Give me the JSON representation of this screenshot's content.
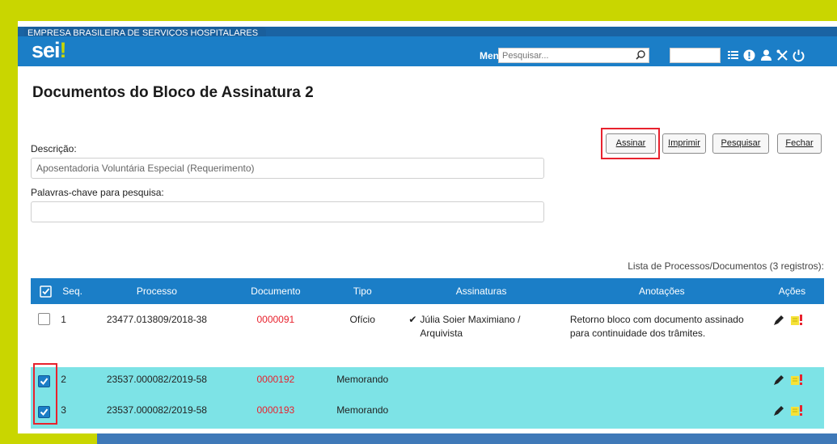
{
  "header": {
    "org_name": "EMPRESA BRASILEIRA DE SERVIÇOS HOSPITALARES",
    "logo_text": "sei",
    "logo_dot": "!",
    "menu_label": "Menu",
    "search_placeholder": "Pesquisar...",
    "icons": [
      "search-icon",
      "list-icon",
      "info-icon",
      "user-icon",
      "tools-icon",
      "power-icon"
    ]
  },
  "page": {
    "title": "Documentos do Bloco de Assinatura 2",
    "buttons": {
      "assinar": "Assinar",
      "imprimir": "Imprimir",
      "pesquisar": "Pesquisar",
      "fechar": "Fechar"
    },
    "descricao_label": "Descrição:",
    "descricao_value": "Aposentadoria Voluntária Especial (Requerimento)",
    "palavras_label": "Palavras-chave para pesquisa:",
    "palavras_value": ""
  },
  "table": {
    "caption": "Lista de Processos/Documentos (3 registros):",
    "columns": [
      "Seq.",
      "Processo",
      "Documento",
      "Tipo",
      "Assinaturas",
      "Anotações",
      "Ações"
    ],
    "rows": [
      {
        "checked": false,
        "seq": "1",
        "processo": "23477.013809/2018-38",
        "documento": "0000091",
        "tipo": "Ofício",
        "assinatura_check": "✔",
        "assinaturas": "Júlia Soier Maximiano / Arquivista",
        "anotacoes": "Retorno bloco com documento assinado para continuidade dos trâmites."
      },
      {
        "checked": true,
        "seq": "2",
        "processo": "23537.000082/2019-58",
        "documento": "0000192",
        "tipo": "Memorando",
        "assinatura_check": "",
        "assinaturas": "",
        "anotacoes": ""
      },
      {
        "checked": true,
        "seq": "3",
        "processo": "23537.000082/2019-58",
        "documento": "0000193",
        "tipo": "Memorando",
        "assinatura_check": "",
        "assinaturas": "",
        "anotacoes": ""
      }
    ]
  },
  "colors": {
    "header_blue": "#1b7ec7",
    "row_highlight": "#7de3e6",
    "document_link": "#e8222e",
    "highlight_box": "#e8222e",
    "frame": "#c9d600"
  }
}
